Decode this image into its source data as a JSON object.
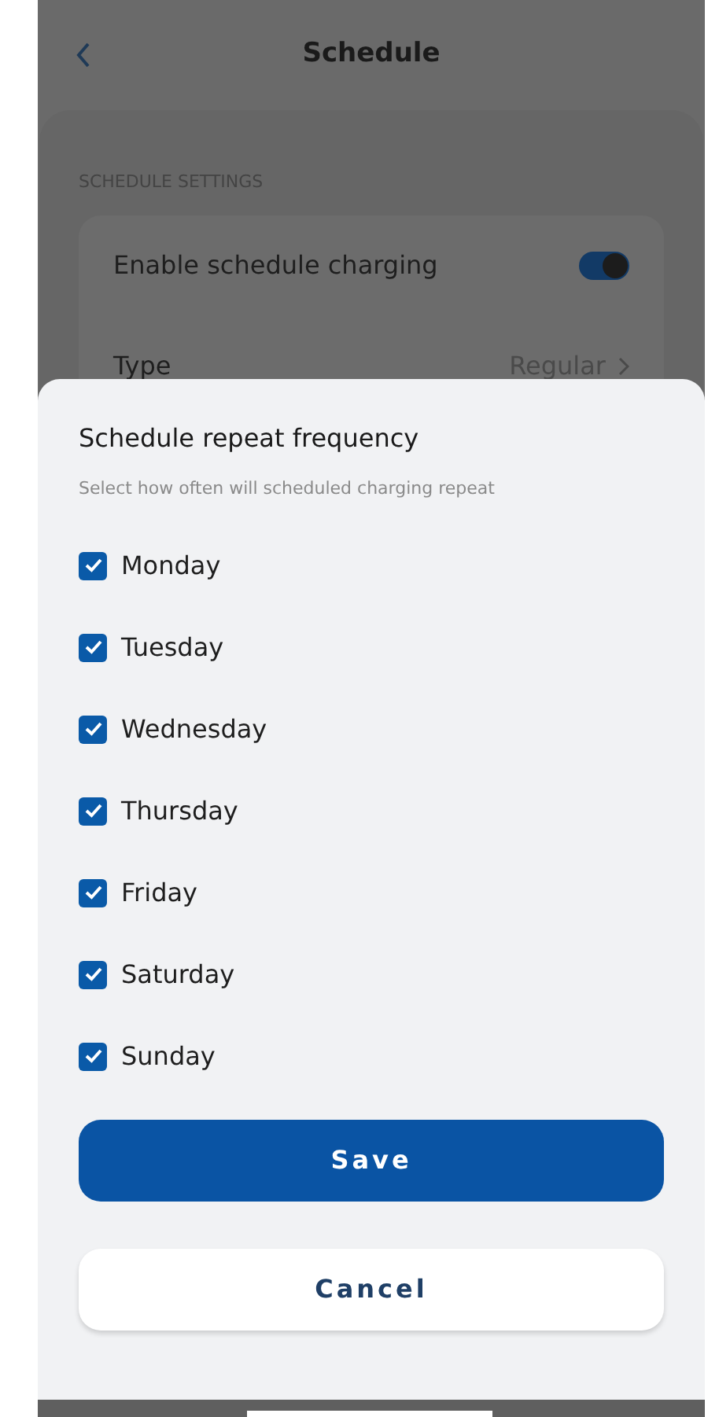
{
  "header": {
    "title": "Schedule"
  },
  "settings": {
    "section_label": "SCHEDULE SETTINGS",
    "rows": [
      {
        "kind": "toggle",
        "label": "Enable schedule charging",
        "on": true
      },
      {
        "kind": "value",
        "label": "Type",
        "value": "Regular"
      }
    ]
  },
  "sheet": {
    "title": "Schedule repeat frequency",
    "subtitle": "Select how often will scheduled charging repeat",
    "days": [
      {
        "label": "Monday",
        "checked": true
      },
      {
        "label": "Tuesday",
        "checked": true
      },
      {
        "label": "Wednesday",
        "checked": true
      },
      {
        "label": "Thursday",
        "checked": true
      },
      {
        "label": "Friday",
        "checked": true
      },
      {
        "label": "Saturday",
        "checked": true
      },
      {
        "label": "Sunday",
        "checked": true
      }
    ],
    "buttons": [
      {
        "kind": "primary",
        "label": "Save"
      },
      {
        "kind": "secondary",
        "label": "Cancel"
      }
    ]
  }
}
